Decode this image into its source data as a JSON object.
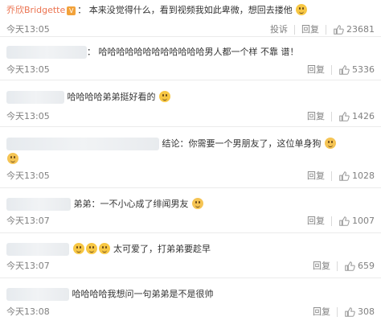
{
  "comments": [
    {
      "user": "乔欣Bridgette",
      "verified": "V",
      "text": "本来没觉得什么，看到视频我如此卑微，想回去搂他",
      "time": "今天13:05",
      "actions": [
        "投诉",
        "回复"
      ],
      "likes": "23681"
    },
    {
      "text": "哈哈哈哈哈哈哈哈哈哈哈哈男人都一个样 不靠 谱！",
      "time": "今天13:05",
      "actions": [
        "回复"
      ],
      "likes": "5336"
    },
    {
      "text": "哈哈哈哈弟弟挺好看的",
      "time": "今天13:05",
      "actions": [
        "回复"
      ],
      "likes": "1426"
    },
    {
      "text": "结论：你需要一个男朋友了，这位单身狗",
      "time": "今天13:05",
      "actions": [
        "回复"
      ],
      "likes": "1028"
    },
    {
      "text": "弟弟：一不小心成了绯闻男友",
      "time": "今天13:07",
      "actions": [
        "回复"
      ],
      "likes": "1007"
    },
    {
      "text": "太可爱了，打弟弟要趁早",
      "time": "今天13:07",
      "actions": [
        "回复"
      ],
      "likes": "659"
    },
    {
      "text": "哈哈哈哈我想问一句弟弟是不是很帅",
      "time": "今天13:08",
      "actions": [
        "回复"
      ],
      "likes": "308"
    }
  ],
  "icons": {
    "like": "thumb-up-icon",
    "verified": "verified-badge-icon",
    "emoji": "smiley-emoji-icon"
  }
}
